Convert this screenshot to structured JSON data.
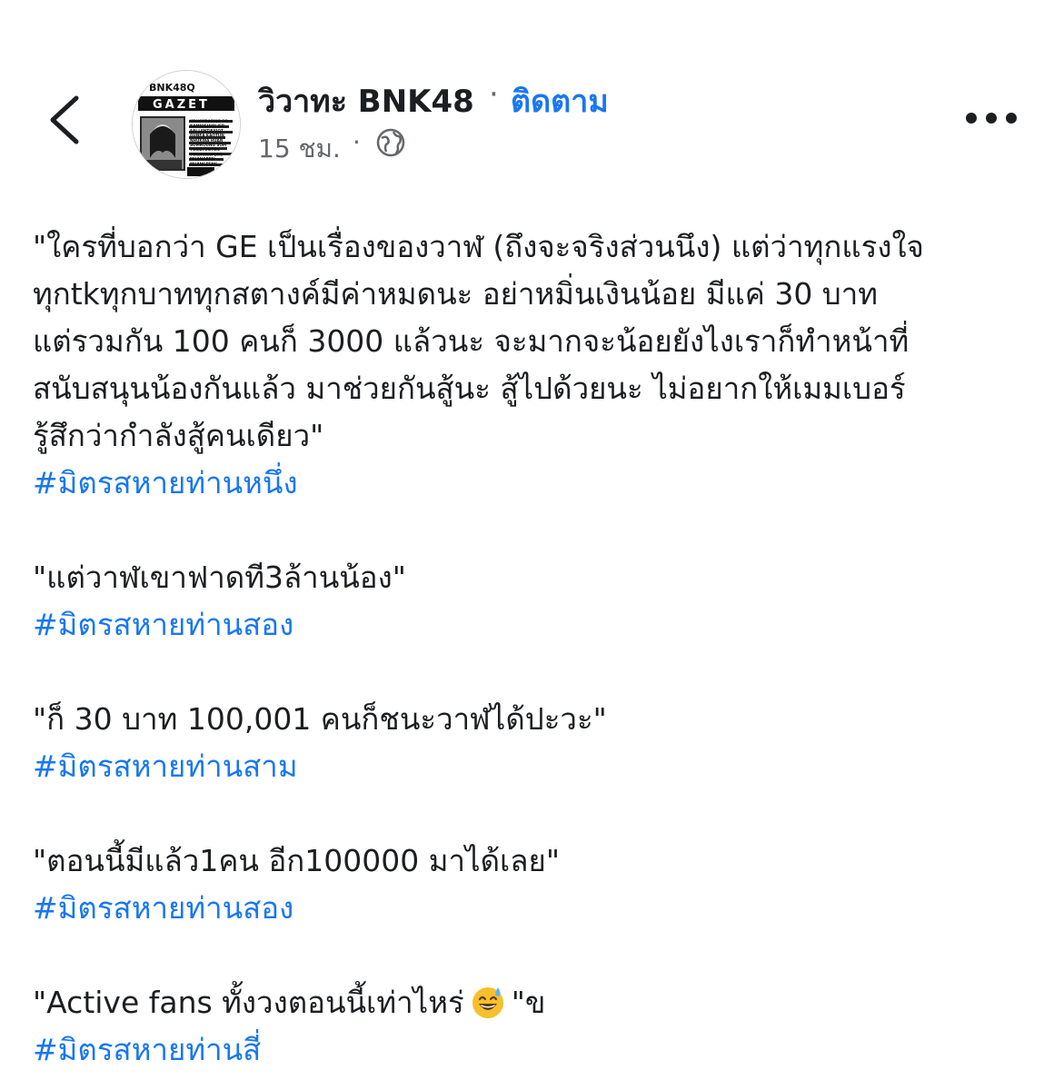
{
  "header": {
    "page_name": "วิวาทะ BNK48",
    "separator": "·",
    "follow_label": "ติดตาม",
    "post_time": "15 ชม.",
    "time_separator": "·",
    "privacy_icon": "globe-icon",
    "back_icon": "chevron-left-icon",
    "more_icon": "more-horizontal-icon",
    "avatar_text": {
      "line1": "BNK48Q",
      "line2": "GAZET",
      "names": [
        "KRUOYRASIUS SO",
        "KAMIOSHIOJ JEB",
        "SAI LENTIEXIOT",
        "GUNEA KAOTUN",
        "NHUKWA HUAN",
        "SOMROUNG SOM",
        "TONGTUNTUN",
        "TUNNGANPENG",
        "MUANGPEN",
        "MUANGPENG"
      ]
    }
  },
  "post": {
    "blocks": [
      {
        "lines": [
          "\"ใครที่บอกว่า GE เป็นเรื่องของวาฬ (ถึงจะจริงส่วนนึง) แต่ว่าทุกแรงใจ",
          "ทุกtkทุกบาททุกสตางค์มีค่าหมดนะ อย่าหมิ่นเงินน้อย มีแค่ 30 บาท",
          "แต่รวมกัน 100 คนก็ 3000 แล้วนะ จะมากจะน้อยยังไงเราก็ทำหน้าที่",
          "สนับสนุนน้องกันแล้ว มาช่วยกันสู้นะ สู้ไปด้วยนะ ไม่อยากให้เมมเบอร์",
          "รู้สึกว่ากำลังสู้คนเดียว\""
        ],
        "hashtag": "#มิตรสหายท่านหนึ่ง"
      },
      {
        "lines": [
          "\"แต่วาฬเขาฟาดที3ล้านน้อง\""
        ],
        "hashtag": "#มิตรสหายท่านสอง"
      },
      {
        "lines": [
          "\"ก็ 30 บาท 100,001 คนก็ชนะวาฬได้ปะวะ\""
        ],
        "hashtag": "#มิตรสหายท่านสาม"
      },
      {
        "lines": [
          "\"ตอนนี้มีแล้ว1คน อีก100000 มาได้เลย\""
        ],
        "hashtag": "#มิตรสหายท่านสอง"
      },
      {
        "line_before_emoji": "\"Active fans ทั้งวงตอนนี้เท่าไหร่",
        "emoji": "grinning-sweat-emoji",
        "line_after_emoji": "\"ข",
        "hashtag": "#มิตรสหายท่านสี่"
      }
    ]
  },
  "colors": {
    "text": "#1c1e21",
    "secondary": "#65676b",
    "link": "#1877f2",
    "emoji_face": "#f7c02b"
  }
}
